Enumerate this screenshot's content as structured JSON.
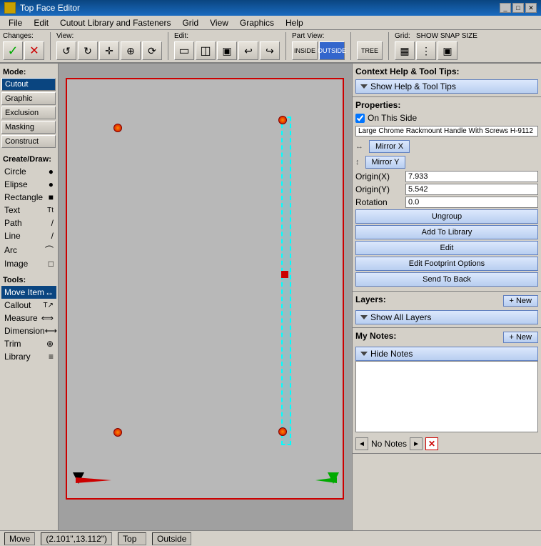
{
  "titleBar": {
    "title": "Top Face Editor",
    "icon": "face-editor-icon"
  },
  "menuBar": {
    "items": [
      "File",
      "Edit",
      "Cutout Library and Fasteners",
      "Grid",
      "View",
      "Graphics",
      "Help"
    ]
  },
  "toolbar": {
    "groups": [
      {
        "label": "Changes:",
        "buttons": [
          {
            "label": "✓",
            "icon": "check-icon",
            "name": "confirm-btn"
          },
          {
            "label": "✕",
            "icon": "cancel-icon",
            "name": "cancel-btn"
          }
        ]
      },
      {
        "label": "View:",
        "buttons": [
          {
            "label": "↺",
            "icon": "rotate-ccw-icon",
            "name": "rotate-ccw-btn"
          },
          {
            "label": "↻",
            "icon": "rotate-cw-icon",
            "name": "rotate-cw-btn"
          },
          {
            "label": "✛",
            "icon": "center-icon",
            "name": "center-btn"
          },
          {
            "label": "⊕",
            "icon": "zoom-fit-icon",
            "name": "zoom-fit-btn"
          },
          {
            "label": "⟳",
            "icon": "refresh-icon",
            "name": "refresh-btn"
          }
        ]
      },
      {
        "label": "Edit:",
        "buttons": [
          {
            "label": "▭",
            "icon": "edit1-icon",
            "name": "edit1-btn"
          },
          {
            "label": "◫",
            "icon": "edit2-icon",
            "name": "edit2-btn"
          },
          {
            "label": "⬡",
            "icon": "edit3-icon",
            "name": "edit3-btn"
          },
          {
            "label": "↩",
            "icon": "undo-icon",
            "name": "undo-btn"
          },
          {
            "label": "↪",
            "icon": "redo-icon",
            "name": "redo-btn"
          }
        ]
      },
      {
        "label": "Part View:",
        "buttons": [
          {
            "label": "INSIDE",
            "icon": "inside-icon",
            "name": "inside-btn"
          },
          {
            "label": "OUTSIDE",
            "icon": "outside-icon",
            "name": "outside-btn",
            "active": true
          }
        ]
      },
      {
        "label": "",
        "buttons": [
          {
            "label": "TREE",
            "icon": "tree-icon",
            "name": "tree-btn"
          }
        ]
      },
      {
        "label": "Grid:",
        "subLabel": "SHOW SNAP SIZE",
        "buttons": [
          {
            "label": "▦",
            "icon": "grid1-icon",
            "name": "grid1-btn"
          },
          {
            "label": "⋮",
            "icon": "grid2-icon",
            "name": "grid2-btn"
          },
          {
            "label": "▣",
            "icon": "grid3-icon",
            "name": "grid3-btn"
          }
        ]
      }
    ]
  },
  "sidebar": {
    "modeLabel": "Mode:",
    "modes": [
      {
        "label": "Cutout",
        "active": true
      },
      {
        "label": "Graphic"
      },
      {
        "label": "Exclusion"
      },
      {
        "label": "Masking"
      },
      {
        "label": "Construct"
      }
    ],
    "createDrawLabel": "Create/Draw:",
    "createItems": [
      {
        "label": "Circle",
        "icon": "●"
      },
      {
        "label": "Elipse",
        "icon": "●"
      },
      {
        "label": "Rectangle",
        "icon": "■"
      },
      {
        "label": "Text",
        "icon": "Tt"
      },
      {
        "label": "Path",
        "icon": "/"
      },
      {
        "label": "Line",
        "icon": "/"
      },
      {
        "label": "Arc",
        "icon": "⌒"
      },
      {
        "label": "Image",
        "icon": "□"
      }
    ],
    "toolsLabel": "Tools:",
    "tools": [
      {
        "label": "Move Item",
        "icon": "↔",
        "active": true
      },
      {
        "label": "Callout",
        "icon": "T↗"
      },
      {
        "label": "Measure",
        "icon": "⟺"
      },
      {
        "label": "Dimension",
        "icon": "⟷"
      },
      {
        "label": "Trim",
        "icon": "⊕"
      },
      {
        "label": "Library",
        "icon": "≡"
      }
    ]
  },
  "rightPanel": {
    "contextHelp": {
      "title": "Context Help & Tool Tips:",
      "showLabel": "Show Help & Tool Tips"
    },
    "properties": {
      "title": "Properties:",
      "onThisSide": "On This Side",
      "itemName": "Large Chrome Rackmount Handle With Screws H-9112",
      "mirrorX": "Mirror X",
      "mirrorY": "Mirror Y",
      "originX": {
        "label": "Origin(X)",
        "value": "7.933"
      },
      "originY": {
        "label": "Origin(Y)",
        "value": "5.542"
      },
      "rotation": {
        "label": "Rotation",
        "value": "0.0"
      },
      "buttons": [
        "Ungroup",
        "Add To Library",
        "Edit",
        "Edit Footprint Options",
        "Send To Back"
      ]
    },
    "layers": {
      "title": "Layers:",
      "newLabel": "+ New",
      "showAllLabel": "Show All Layers"
    },
    "myNotes": {
      "title": "My Notes:",
      "newLabel": "+ New",
      "hideLabel": "Hide Notes",
      "notesContent": "",
      "noNotesLabel": "No Notes"
    }
  },
  "statusBar": {
    "action": "Move",
    "coordinates": "(2.101\",13.112\")",
    "view": "Top",
    "side": "Outside"
  }
}
